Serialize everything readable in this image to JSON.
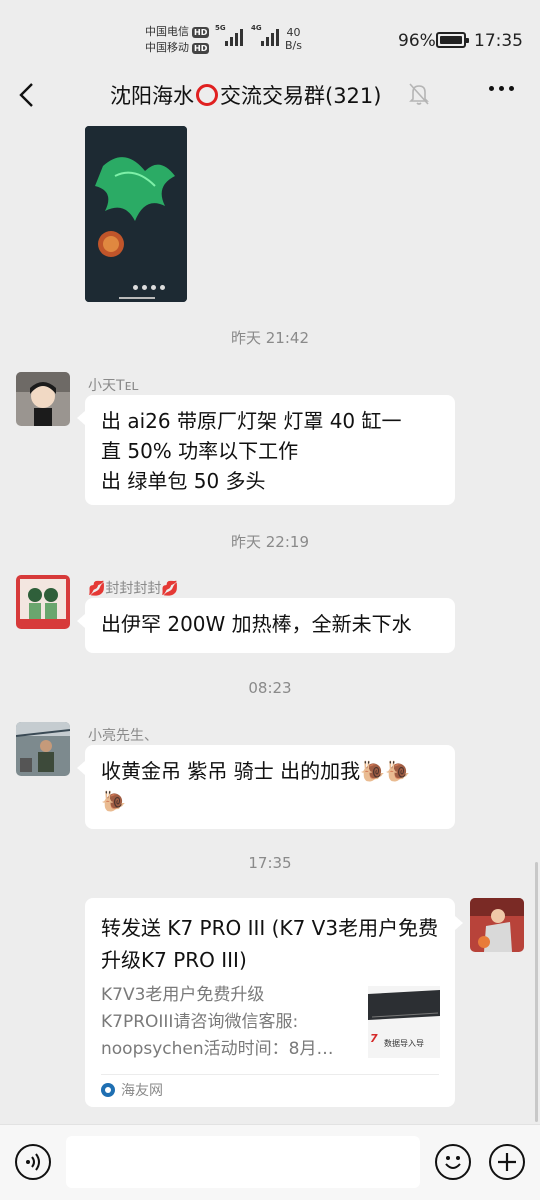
{
  "status_bar": {
    "carrier1": "中国电信",
    "carrier2": "中国移动",
    "hd": "HD",
    "sig1_tag": "5G",
    "sig2_tag": "4G",
    "speed_value": "40",
    "speed_unit": "B/s",
    "battery_pct": "96%",
    "battery_level": 0.96,
    "time": "17:35"
  },
  "nav": {
    "title_left": "沈阳海水",
    "title_right": "交流交易群(321)"
  },
  "chat": {
    "time1": "昨天 21:42",
    "msg1": {
      "sender": "小天Tᴇʟ",
      "lines": [
        "出 ai26 带原厂灯架 灯罩  40 缸一",
        "直 50% 功率以下工作",
        "出  绿单包  50 多头"
      ]
    },
    "time2": "昨天 22:19",
    "msg2": {
      "sender": "💋封封封封💋",
      "text": "出伊罕 200W 加热棒，全新未下水"
    },
    "time3": "08:23",
    "msg3": {
      "sender": "小亮先生、",
      "line1": "收黄金吊 紫吊 骑士 出的加我🐌🐌",
      "line2": "🐌"
    },
    "time4": "17:35",
    "card": {
      "title": "转发送 K7 PRO III (K7 V3老用户免费升级K7 PRO III)",
      "desc_lines": [
        "K7V3老用户免费升级",
        "K7PROIII请咨询微信客服:",
        "noopsychen活动时间：8月…"
      ],
      "thumb_text": "数据导入导",
      "thumb_brand": "7",
      "source": "海友网"
    }
  },
  "input": {
    "placeholder": ""
  },
  "colors": {
    "background": "#ededed",
    "bubble": "#ffffff",
    "accent_red": "#e02020"
  }
}
